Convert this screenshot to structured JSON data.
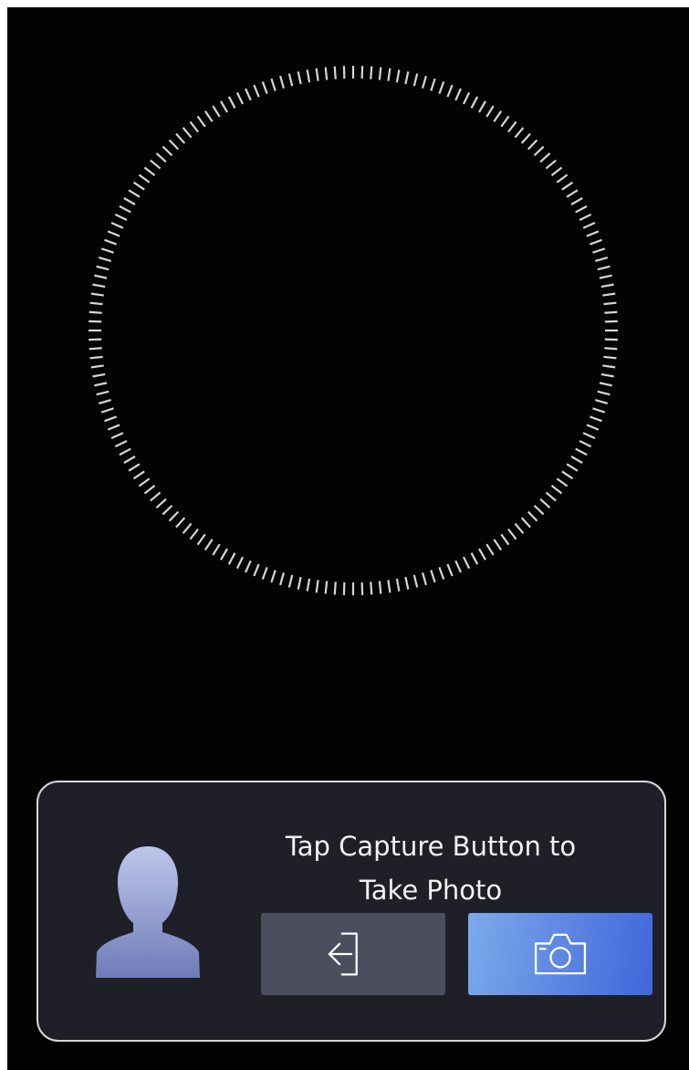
{
  "screen": {
    "background": "#030303",
    "viewfinder": {
      "shape": "dashed-circle",
      "color": "#d6d6d6"
    }
  },
  "panel": {
    "prompt_text": "Tap Capture Button to\nTake Photo",
    "avatar_icon": "person-silhouette-icon",
    "exit_button": {
      "icon": "exit-arrow-icon",
      "color": "#4b4f5d"
    },
    "capture_button": {
      "icon": "camera-icon",
      "color": "#5b84e2"
    }
  }
}
